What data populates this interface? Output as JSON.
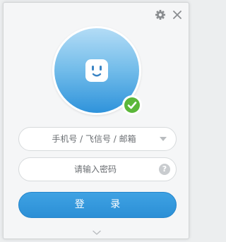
{
  "account_field": {
    "placeholder": "手机号 / 飞信号 / 邮箱"
  },
  "password_field": {
    "placeholder": "请输入密码",
    "help_glyph": "?"
  },
  "login_button": {
    "label": "登 录"
  },
  "icons": {
    "settings": "gear-icon",
    "close": "close-icon",
    "status": "checkmark-icon",
    "dropdown": "chevron-down-icon",
    "help": "question-icon",
    "expand": "chevron-down-icon"
  },
  "colors": {
    "accent": "#2f93db",
    "status_online": "#5bb73a",
    "window_bg": "#f5f6f7"
  }
}
